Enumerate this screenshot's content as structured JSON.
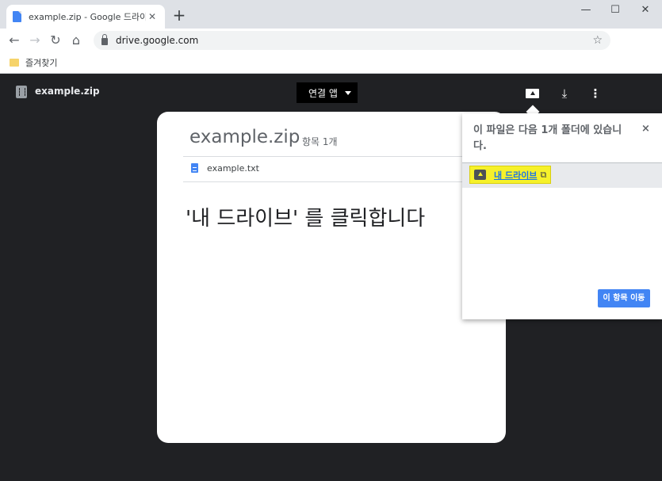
{
  "browser": {
    "tab_title": "example.zip - Google 드라이브",
    "tab_close": "✕",
    "new_tab": "+",
    "window_controls": {
      "minimize": "—",
      "maximize": "☐",
      "close": "✕"
    },
    "nav": {
      "back": "←",
      "forward": "→",
      "reload": "↻",
      "home": "⌂"
    },
    "url": "drive.google.com",
    "bookmark_star": "☆",
    "bookmarks_folder": "즐겨찾기"
  },
  "drive_bar": {
    "filename": "example.zip",
    "open_with_label": "연결 앱",
    "download_glyph": "⤓",
    "more_glyph": "⋮"
  },
  "card": {
    "title": "example.zip",
    "item_count": "항목 1개",
    "file_name": "example.txt",
    "instruction": "'내 드라이브' 를 클릭합니다"
  },
  "popup": {
    "text": "이 파일은 다음 1개 폴더에 있습니다.",
    "close": "×",
    "location_label": "내 드라이브",
    "external_glyph": "⧉",
    "move_button": "이 항목 이동"
  },
  "colors": {
    "accent": "#4285f4",
    "highlight": "#f6f12a",
    "viewer_background": "#202124"
  }
}
